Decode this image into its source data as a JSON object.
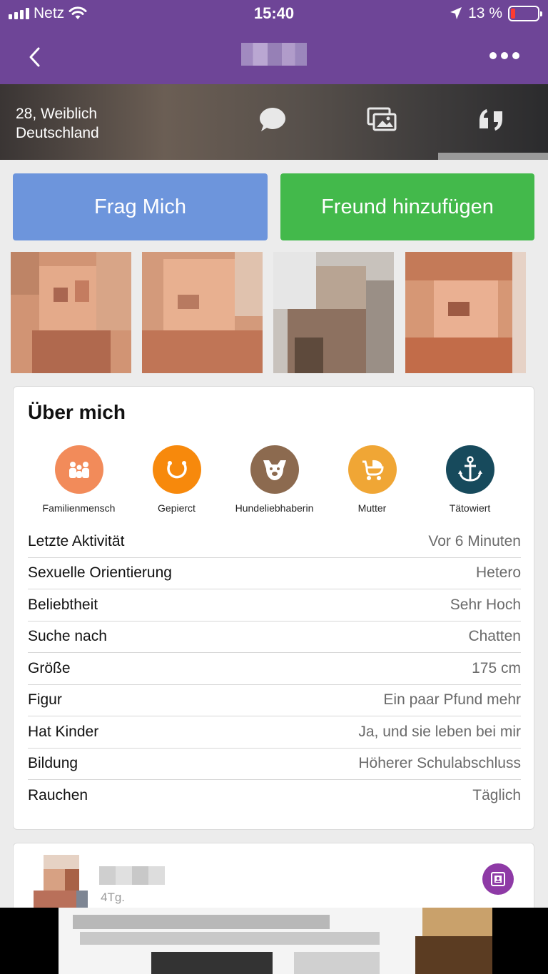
{
  "status": {
    "carrier": "Netz",
    "time": "15:40",
    "battery": "13 %",
    "battery_level": 0.13
  },
  "profile": {
    "line1": "28, Weiblich",
    "line2": "Deutschland"
  },
  "actions": {
    "ask_label": "Frag Mich",
    "add_label": "Freund hinzufügen"
  },
  "about": {
    "title": "Über mich",
    "traits": [
      {
        "label": "Familienmensch",
        "icon": "family-icon",
        "color": "#f28b5a"
      },
      {
        "label": "Gepierct",
        "icon": "piercing-icon",
        "color": "#f7890c"
      },
      {
        "label": "Hundeliebhaberin",
        "icon": "dog-icon",
        "color": "#8c6a4f"
      },
      {
        "label": "Mutter",
        "icon": "stroller-icon",
        "color": "#f0a635"
      },
      {
        "label": "Tätowiert",
        "icon": "anchor-icon",
        "color": "#174a5c"
      }
    ],
    "rows": [
      {
        "key": "Letzte Aktivität",
        "value": "Vor 6 Minuten"
      },
      {
        "key": "Sexuelle Orientierung",
        "value": "Hetero"
      },
      {
        "key": "Beliebtheit",
        "value": "Sehr Hoch"
      },
      {
        "key": "Suche nach",
        "value": "Chatten"
      },
      {
        "key": "Größe",
        "value": "175 cm"
      },
      {
        "key": "Figur",
        "value": "Ein paar Pfund mehr"
      },
      {
        "key": "Hat Kinder",
        "value": "Ja, und sie leben bei mir"
      },
      {
        "key": "Bildung",
        "value": "Höherer Schulabschluss"
      },
      {
        "key": "Rauchen",
        "value": "Täglich"
      }
    ]
  },
  "activity": {
    "ago": "4Tg."
  },
  "colors": {
    "brand": "#6e4597",
    "ask_button": "#6d95dc",
    "add_button": "#43b94b",
    "album_badge": "#8e3aa6"
  }
}
